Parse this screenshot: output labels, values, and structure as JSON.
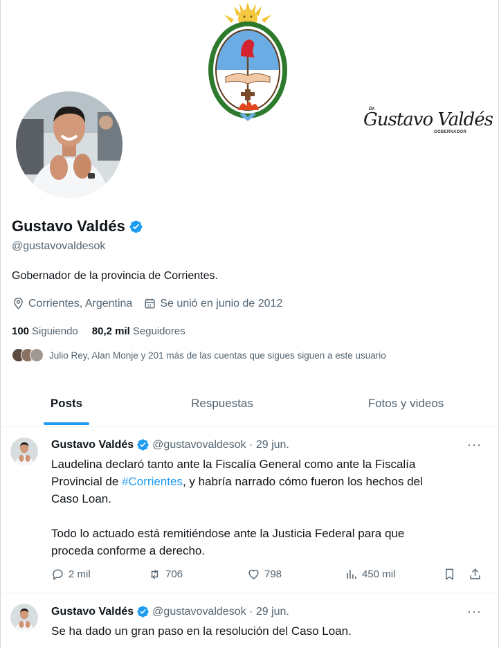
{
  "banner": {
    "signature_prefix": "Dr.",
    "signature_name": "Gustavo Valdés",
    "signature_role": "GOBERNADOR"
  },
  "profile": {
    "name": "Gustavo Valdés",
    "handle": "@gustavovaldesok",
    "bio": "Gobernador de la provincia de Corrientes.",
    "location": "Corrientes, Argentina",
    "joined": "Se unió en junio de 2012",
    "following_count": "100",
    "following_label": "Siguiendo",
    "followers_count": "80,2 mil",
    "followers_label": "Seguidores",
    "followed_by": "Julio Rey, Alan Monje y 201 más de las cuentas que sigues siguen a este usuario"
  },
  "tabs": [
    {
      "label": "Posts",
      "active": true
    },
    {
      "label": "Respuestas",
      "active": false
    },
    {
      "label": "Fotos y videos",
      "active": false
    }
  ],
  "tweets": [
    {
      "name": "Gustavo Valdés",
      "handle_date": "@gustavovaldesok · 29 jun.",
      "line1": "Laudelina declaró tanto ante la Fiscalía General como ante la Fiscalía",
      "line2_pre": "Provincial de ",
      "line2_hashtag": "#Corrientes",
      "line2_post": ",  y habría narrado cómo fueron los hechos del",
      "line3": "Caso Loan.",
      "line4": "Todo lo actuado está remitiéndose ante la Justicia Federal para que",
      "line5": "proceda conforme a derecho.",
      "replies": "2 mil",
      "reposts": "706",
      "likes": "798",
      "views": "450 mil"
    },
    {
      "name": "Gustavo Valdés",
      "handle_date": "@gustavovaldesok · 29 jun.",
      "line1": "Se ha dado un gran paso en la resolución del Caso Loan."
    }
  ],
  "more_icon": "···",
  "colors": {
    "accent": "#1d9bf0",
    "text_primary": "#0f1419",
    "text_secondary": "#536471"
  },
  "icons": [
    "location-icon",
    "calendar-icon",
    "verified-badge-icon",
    "reply-icon",
    "repost-icon",
    "like-icon",
    "views-icon",
    "bookmark-icon",
    "share-icon",
    "more-icon"
  ]
}
